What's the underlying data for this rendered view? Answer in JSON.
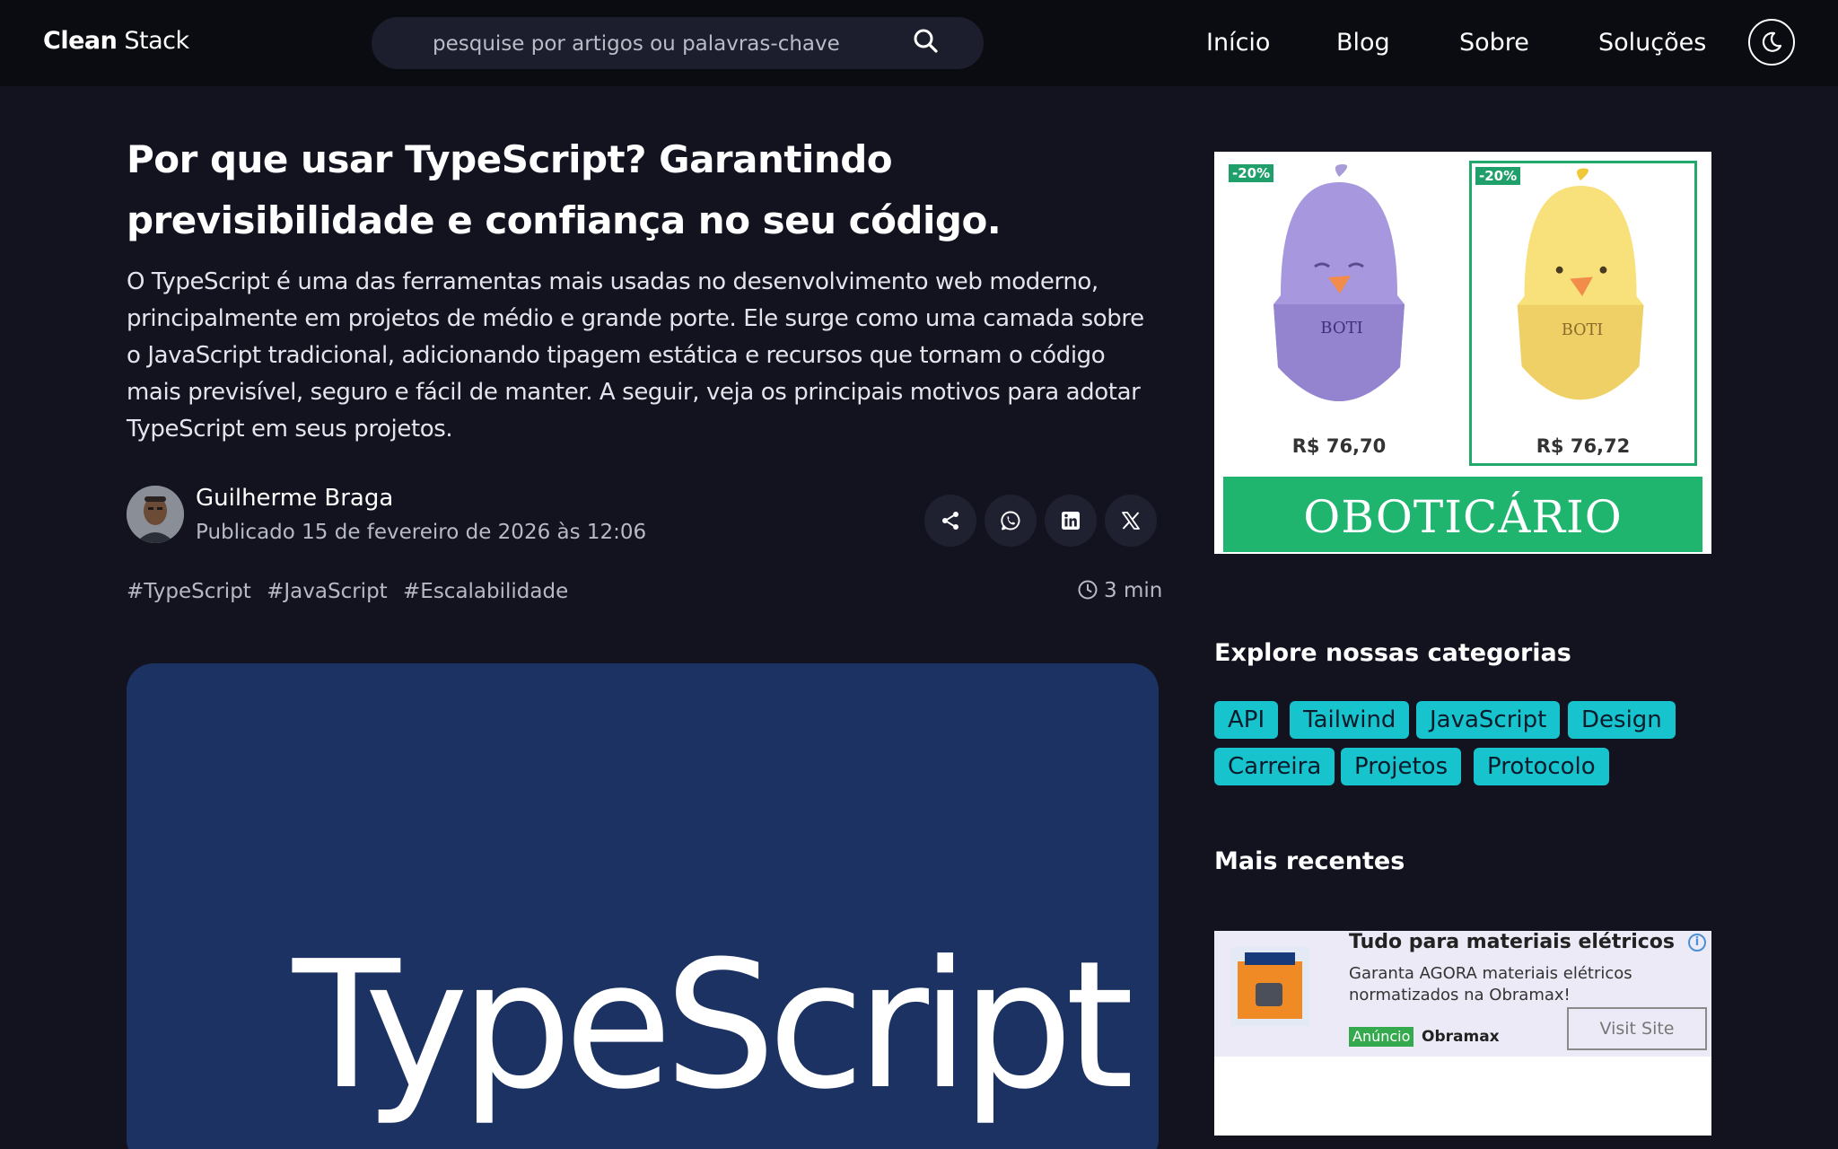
{
  "header": {
    "logo_bold": "Clean",
    "logo_rest": " Stack",
    "search_placeholder": "pesquise por artigos ou palavras-chave",
    "nav": [
      "Início",
      "Blog",
      "Sobre",
      "Soluções"
    ]
  },
  "article": {
    "title": "Por que usar TypeScript? Garantindo previsibilidade e confiança no seu código.",
    "lead": "O TypeScript é uma das ferramentas mais usadas no desenvolvimento web moderno, principalmente em projetos de médio e grande porte. Ele surge como uma camada sobre o JavaScript tradicional, adicionando tipagem estática e recursos que tornam o código mais previsível, seguro e fácil de manter. A seguir, veja os principais motivos para adotar TypeScript em seus projetos.",
    "author": "Guilherme Braga",
    "published": "Publicado 15 de fevereiro de 2026 às 12:06",
    "tags": [
      "#TypeScript",
      "#JavaScript",
      "#Escalabilidade"
    ],
    "read_time": "3 min",
    "hero_text": "TypeScript"
  },
  "share_icons": [
    "share-icon",
    "whatsapp-icon",
    "linkedin-icon",
    "x-icon"
  ],
  "ad_top": {
    "products": [
      {
        "discount": "-20%",
        "price": "R$ 76,70"
      },
      {
        "discount": "-20%",
        "price": "R$ 76,72"
      }
    ],
    "brand": "OBOTICÁRIO"
  },
  "sidebar": {
    "categories_title": "Explore nossas categorias",
    "categories": [
      "API",
      "Tailwind",
      "JavaScript",
      "Design",
      "Carreira",
      "Projetos",
      "Protocolo"
    ],
    "recent_title": "Mais recentes"
  },
  "ad_bottom": {
    "title": "Tudo para materiais elétricos",
    "description": "Garanta AGORA materiais elétricos normatizados na Obramax!",
    "badge": "Anúncio",
    "advertiser": "Obramax",
    "cta": "Visit Site"
  },
  "colors": {
    "background": "#12131f",
    "navbar": "#0b0c12",
    "chip": "#17c4ce",
    "hero": "#1c3263",
    "brand_green": "#1fb56f"
  }
}
